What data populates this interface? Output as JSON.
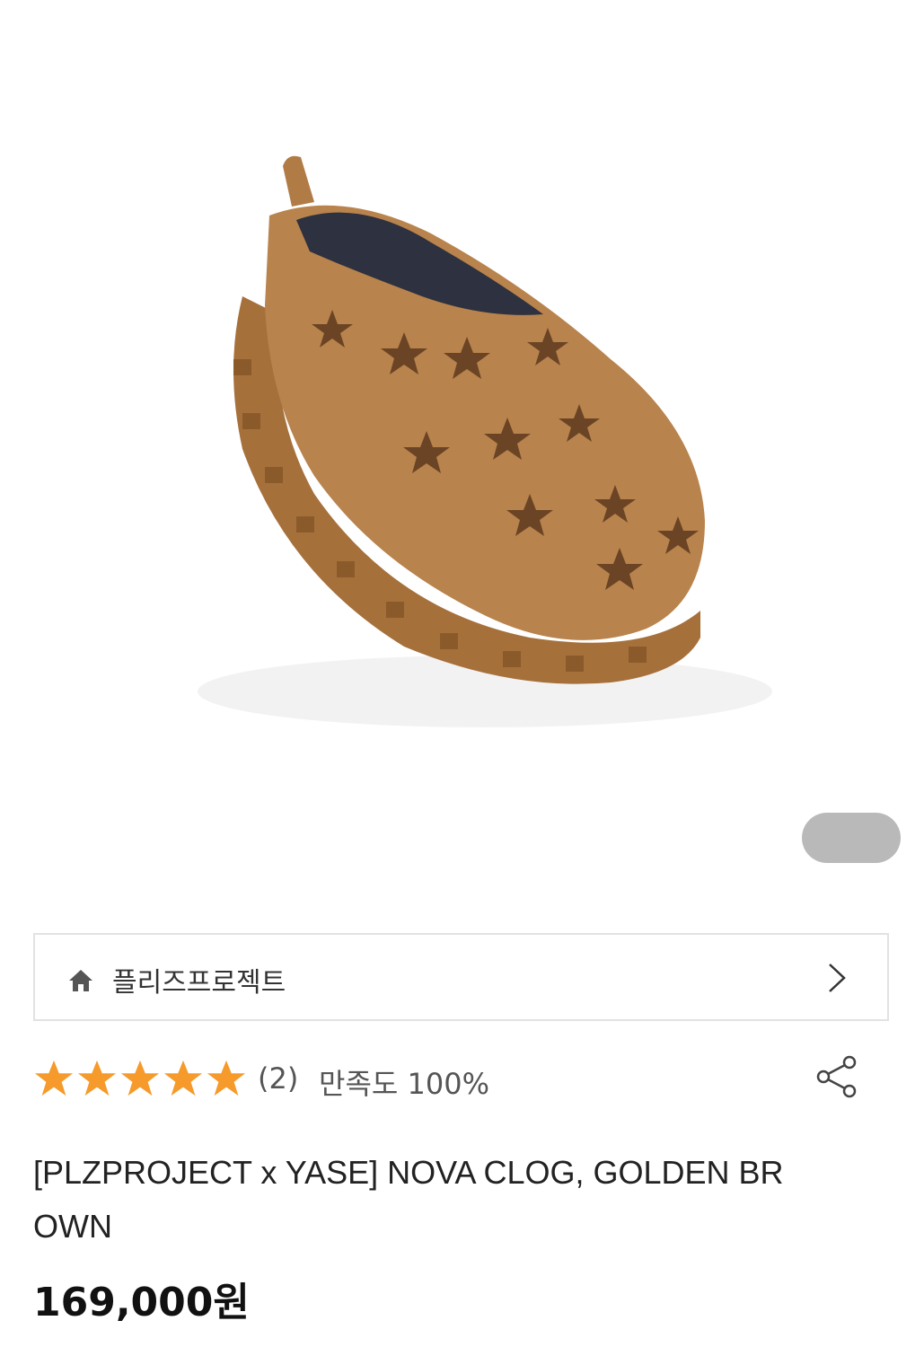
{
  "store": {
    "name": "플리즈프로젝트"
  },
  "rating": {
    "stars": 5,
    "max_stars": 5,
    "review_count": "(2)",
    "satisfaction": "만족도 100%"
  },
  "product": {
    "title": "[PLZPROJECT x YASE] NOVA CLOG, GOLDEN BROWN",
    "price": "169,000원"
  },
  "colors": {
    "star": "#f59a2b",
    "suede": "#b07b45",
    "text": "#222222"
  },
  "icons": {
    "home": "home-icon",
    "chevron": "chevron-right-icon",
    "share": "share-icon"
  }
}
